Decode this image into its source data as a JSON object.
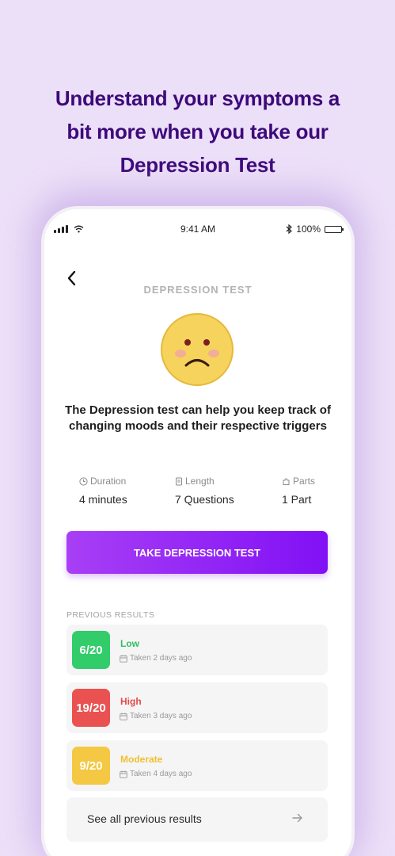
{
  "headline": {
    "line1": "Understand your symptoms a",
    "line2": "bit more when you take our",
    "line3": "Depression Test"
  },
  "status_bar": {
    "time": "9:41 AM",
    "battery": "100%"
  },
  "screen": {
    "title": "DEPRESSION TEST",
    "emoji_icon": "sad-face-icon",
    "description": "The Depression test can help you keep track of changing moods and their respective triggers"
  },
  "stats": [
    {
      "label": "Duration",
      "value": "4 minutes",
      "icon": "clock-icon"
    },
    {
      "label": "Length",
      "value": "7 Questions",
      "icon": "document-icon"
    },
    {
      "label": "Parts",
      "value": "1 Part",
      "icon": "puzzle-icon"
    }
  ],
  "cta": {
    "label": "TAKE DEPRESSION TEST"
  },
  "previous_results": {
    "heading": "PREVIOUS RESULTS",
    "items": [
      {
        "score": "6/20",
        "level": "Low",
        "taken": "Taken 2 days ago",
        "color": "#33cc6b",
        "text_color": "#2fbf62"
      },
      {
        "score": "19/20",
        "level": "High",
        "taken": "Taken 3 days ago",
        "color": "#ea5252",
        "text_color": "#e24a4a"
      },
      {
        "score": "9/20",
        "level": "Moderate",
        "taken": "Taken 4 days ago",
        "color": "#f4c842",
        "text_color": "#f0c030"
      }
    ],
    "see_all": "See all previous results"
  },
  "colors": {
    "background": "#ecdff8",
    "headline": "#3d0a7a",
    "accent_start": "#a83ff5",
    "accent_end": "#8210f5"
  }
}
